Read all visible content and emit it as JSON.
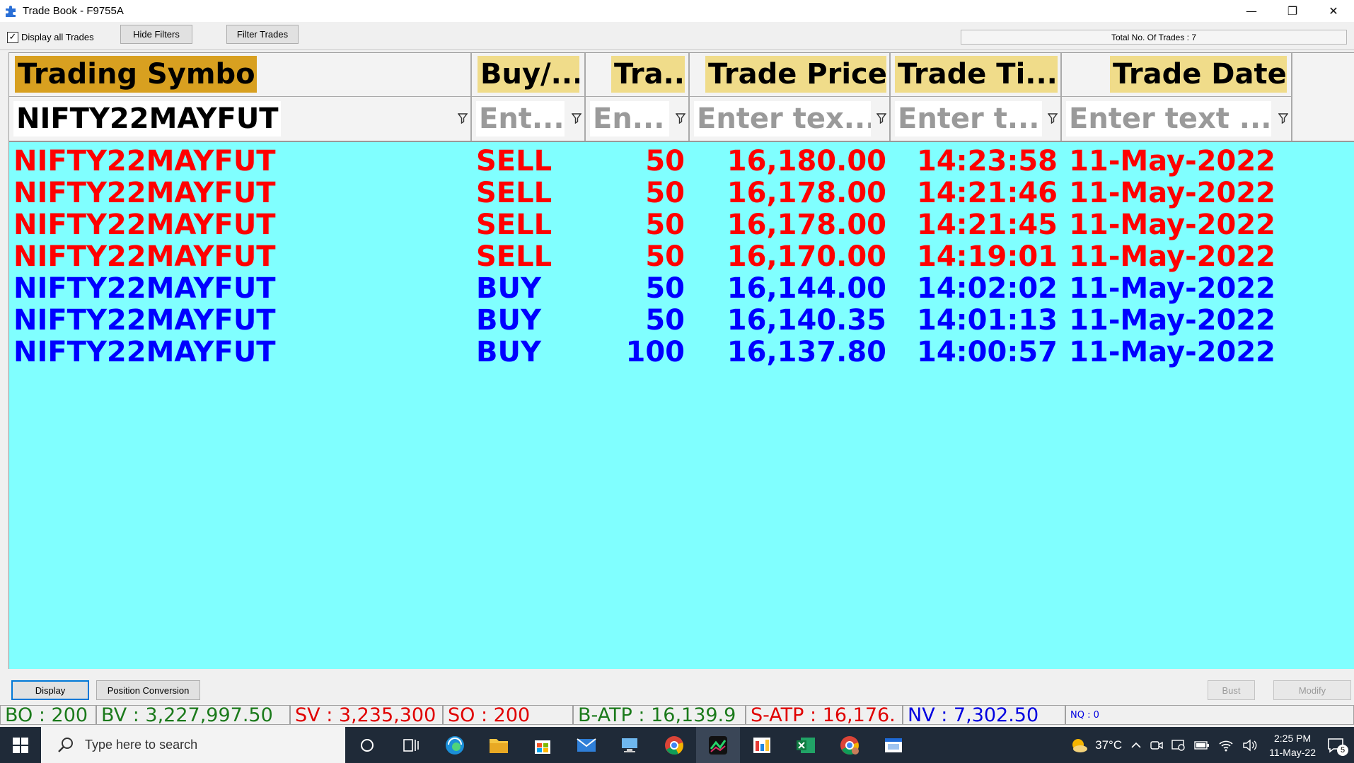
{
  "window": {
    "title": "Trade Book - F9755A",
    "minimize": "—",
    "restore": "❐",
    "close": "✕"
  },
  "toolbar": {
    "display_all_label": "Display all Trades",
    "display_all_checked": "✓",
    "hide_filters_label": "Hide Filters",
    "filter_trades_label": "Filter Trades",
    "total_trades": "Total No. Of Trades : 7"
  },
  "grid": {
    "columns": [
      {
        "header": "Trading Symbol",
        "filter": "NIFTY22MAYFUT"
      },
      {
        "header": "Buy/...",
        "filter": "Ent..."
      },
      {
        "header": "Tra...",
        "filter": "En..."
      },
      {
        "header": "Trade Price",
        "filter": "Enter tex..."
      },
      {
        "header": "Trade Ti...",
        "filter": "Enter t..."
      },
      {
        "header": "Trade Date",
        "filter": "Enter text ..."
      }
    ],
    "rows": [
      {
        "symbol": "NIFTY22MAYFUT",
        "side": "SELL",
        "qty": "50",
        "price": "16,180.00",
        "time": "14:23:58",
        "date": "11-May-2022"
      },
      {
        "symbol": "NIFTY22MAYFUT",
        "side": "SELL",
        "qty": "50",
        "price": "16,178.00",
        "time": "14:21:46",
        "date": "11-May-2022"
      },
      {
        "symbol": "NIFTY22MAYFUT",
        "side": "SELL",
        "qty": "50",
        "price": "16,178.00",
        "time": "14:21:45",
        "date": "11-May-2022"
      },
      {
        "symbol": "NIFTY22MAYFUT",
        "side": "SELL",
        "qty": "50",
        "price": "16,170.00",
        "time": "14:19:01",
        "date": "11-May-2022"
      },
      {
        "symbol": "NIFTY22MAYFUT",
        "side": "BUY",
        "qty": "50",
        "price": "16,144.00",
        "time": "14:02:02",
        "date": "11-May-2022"
      },
      {
        "symbol": "NIFTY22MAYFUT",
        "side": "BUY",
        "qty": "50",
        "price": "16,140.35",
        "time": "14:01:13",
        "date": "11-May-2022"
      },
      {
        "symbol": "NIFTY22MAYFUT",
        "side": "BUY",
        "qty": "100",
        "price": "16,137.80",
        "time": "14:00:57",
        "date": "11-May-2022"
      }
    ]
  },
  "bottom": {
    "display_label": "Display",
    "position_conversion_label": "Position Conversion",
    "bust_label": "Bust",
    "modify_label": "Modify"
  },
  "status": {
    "bo": "BO : 200",
    "bv": "BV : 3,227,997.50",
    "sv": "SV : 3,235,300",
    "so": "SO : 200",
    "b_atp": "B-ATP : 16,139.9",
    "s_atp": "S-ATP : 16,176.",
    "nv": "NV : 7,302.50",
    "nq": "NQ : 0"
  },
  "taskbar": {
    "search_placeholder": "Type here to search",
    "temperature": "37°C",
    "time": "2:25 PM",
    "date": "11-May-22",
    "notification_count": "5"
  },
  "colors": {
    "grid_bg": "#80ffff",
    "sell": "#ff0000",
    "buy": "#0000ff",
    "header_primary": "#d8a020",
    "header": "#f0dc8a"
  }
}
